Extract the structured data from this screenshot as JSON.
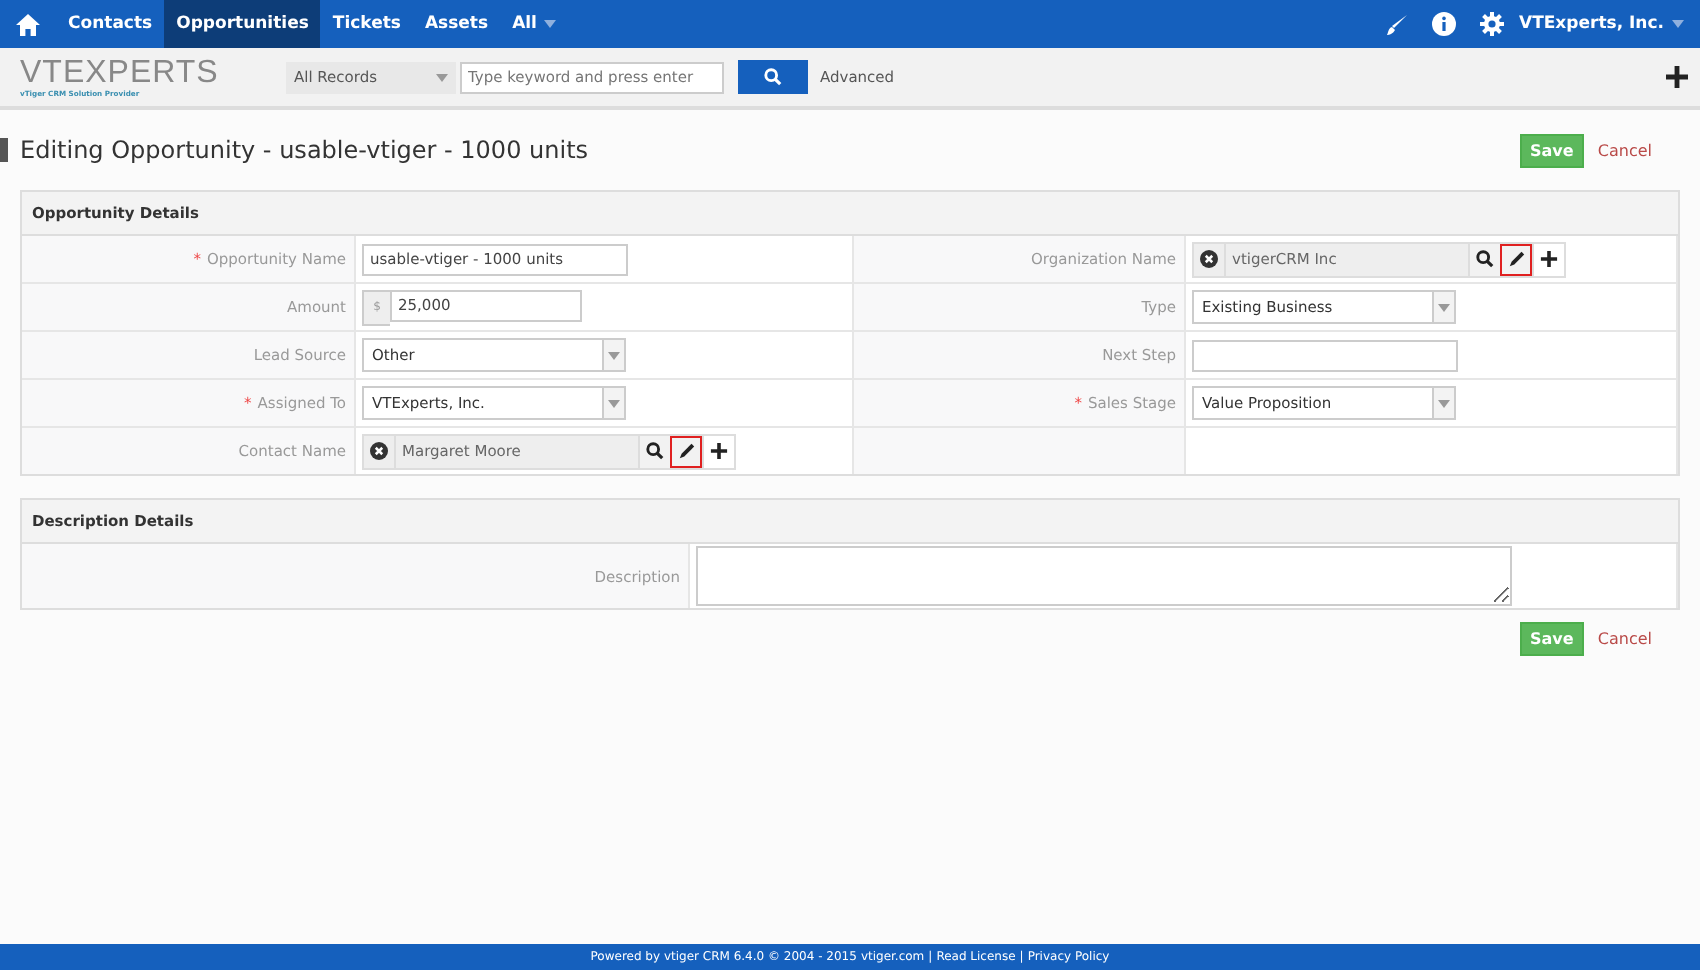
{
  "top_nav": {
    "tabs": [
      {
        "label": "Contacts",
        "selected": false
      },
      {
        "label": "Opportunities",
        "selected": true
      },
      {
        "label": "Tickets",
        "selected": false
      },
      {
        "label": "Assets",
        "selected": false
      },
      {
        "label": "All",
        "selected": false,
        "dropdown": true
      }
    ],
    "user": "VTExperts, Inc."
  },
  "header": {
    "logo": "VTEXPERTS",
    "logo_tagline": "vTiger  CRM  Solution  Provider",
    "filter": "All Records",
    "search_placeholder": "Type keyword and press enter",
    "advanced": "Advanced"
  },
  "page_title": "Editing Opportunity - usable-vtiger - 1000 units",
  "actions": {
    "save": "Save",
    "cancel": "Cancel"
  },
  "opportunity_details": {
    "title": "Opportunity Details",
    "rows": [
      {
        "left": {
          "label": "Opportunity Name",
          "required_mark": "*",
          "kind": "text",
          "value": "usable-vtiger - 1000 units"
        },
        "right": {
          "label": "Organization Name",
          "kind": "reference",
          "value": "vtigerCRM Inc",
          "edit_highlighted": true
        }
      },
      {
        "left": {
          "label": "Amount",
          "kind": "currency",
          "symbol": "$",
          "value": "25,000"
        },
        "right": {
          "label": "Type",
          "kind": "select",
          "value": "Existing Business"
        }
      },
      {
        "left": {
          "label": "Lead Source",
          "kind": "select",
          "value": "Other"
        },
        "right": {
          "label": "Next Step",
          "kind": "text"
        }
      },
      {
        "left": {
          "label": "Assigned To",
          "required_mark": "*",
          "kind": "select",
          "value": "VTExperts, Inc."
        },
        "right": {
          "label": "Sales Stage",
          "required_mark": "*",
          "kind": "select",
          "value": "Value Proposition"
        }
      },
      {
        "left": {
          "label": "Contact Name",
          "kind": "reference",
          "value": "Margaret Moore",
          "edit_highlighted": true
        }
      }
    ]
  },
  "description_details": {
    "title": "Description Details",
    "label": "Description"
  },
  "bottom_actions": {
    "save": "Save",
    "cancel": "Cancel"
  },
  "footer": {
    "text": "Powered by vtiger CRM 6.4.0  © 2004 - 2015 ",
    "links": [
      "vtiger.com",
      "Read License",
      "Privacy Policy"
    ],
    "separator": "|"
  }
}
